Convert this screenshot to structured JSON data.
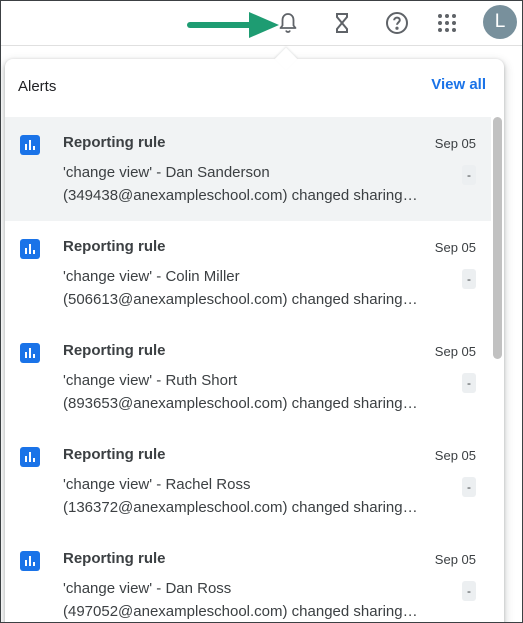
{
  "header": {
    "icons": [
      {
        "name": "notifications-bell-icon"
      },
      {
        "name": "hourglass-icon"
      },
      {
        "name": "help-icon"
      },
      {
        "name": "apps-grid-icon"
      }
    ],
    "avatar_initial": "L",
    "avatar_color": "#78909c",
    "arrow_color": "#1e9c72"
  },
  "alerts": {
    "title": "Alerts",
    "view_all": "View all",
    "items": [
      {
        "title": "Reporting rule",
        "date": "Sep 05",
        "line1": "'change view' - Dan Sanderson",
        "line2": "(349438@anexampleschool.com) changed sharing…",
        "badge": "-",
        "selected": true
      },
      {
        "title": "Reporting rule",
        "date": "Sep 05",
        "line1": "'change view' - Colin Miller",
        "line2": "(506613@anexampleschool.com) changed sharing…",
        "badge": "-",
        "selected": false
      },
      {
        "title": "Reporting rule",
        "date": "Sep 05",
        "line1": "'change view' - Ruth Short",
        "line2": "(893653@anexampleschool.com) changed sharing…",
        "badge": "-",
        "selected": false
      },
      {
        "title": "Reporting rule",
        "date": "Sep 05",
        "line1": "'change view' - Rachel Ross",
        "line2": "(136372@anexampleschool.com) changed sharing…",
        "badge": "-",
        "selected": false
      },
      {
        "title": "Reporting rule",
        "date": "Sep 05",
        "line1": "'change view' - Dan Ross",
        "line2": "(497052@anexampleschool.com) changed sharing…",
        "badge": "-",
        "selected": false
      }
    ]
  },
  "colors": {
    "accent": "#1a73e8",
    "selected_row": "#f1f3f4"
  }
}
